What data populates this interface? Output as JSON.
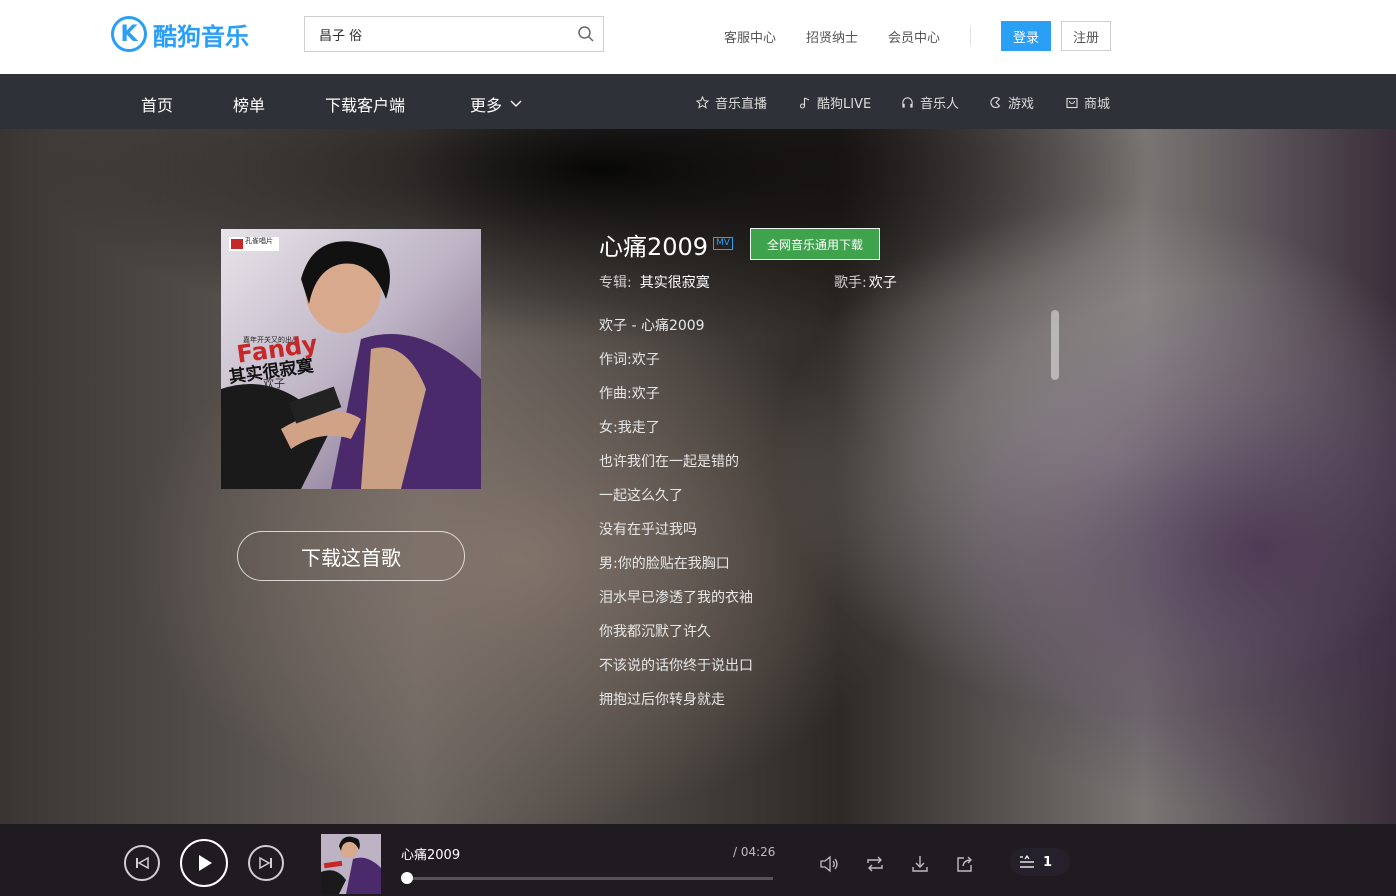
{
  "header": {
    "logo_letter": "K",
    "logo_text": "酷狗音乐",
    "search": {
      "value": "昌子 俗",
      "placeholder": ""
    },
    "links": [
      "客服中心",
      "招贤纳士",
      "会员中心"
    ],
    "login_label": "登录",
    "register_label": "注册",
    "accent_color": "#2a9ff6"
  },
  "nav": {
    "main": [
      {
        "label": "首页"
      },
      {
        "label": "榜单"
      },
      {
        "label": "下载客户端"
      },
      {
        "label": "更多"
      }
    ],
    "right": [
      {
        "label": "音乐直播",
        "icon": "star-icon"
      },
      {
        "label": "酷狗LIVE",
        "icon": "music-note-icon"
      },
      {
        "label": "音乐人",
        "icon": "headphones-icon"
      },
      {
        "label": "游戏",
        "icon": "game-icon"
      },
      {
        "label": "商城",
        "icon": "shop-icon"
      }
    ]
  },
  "song": {
    "title": "心痛2009",
    "mv_badge": "MV",
    "download_all_label": "全网音乐通用下载",
    "album_key": "专辑:",
    "album": "其实很寂寞",
    "singer_key": "歌手:",
    "singer": "欢子",
    "download_song_label": "下载这首歌",
    "download_all_color": "#3fa34d",
    "cover": {
      "label_tag": "孔雀唱片",
      "top_tagline": "嘉年开关又的出品",
      "title_en": "Fandy",
      "title_cn": "其实很寂寞",
      "artist": "欢子"
    }
  },
  "lyrics": [
    "欢子 - 心痛2009",
    "作词:欢子",
    "作曲:欢子",
    "女:我走了",
    "也许我们在一起是错的",
    "一起这么久了",
    "没有在乎过我吗",
    "男:你的脸贴在我胸口",
    "泪水早已渗透了我的衣袖",
    "你我都沉默了许久",
    "不该说的话你终于说出口",
    "拥抱过后你转身就走"
  ],
  "player": {
    "title": "心痛2009",
    "time": "/ 04:26",
    "progress": 0.0,
    "playlist_count": "1"
  }
}
